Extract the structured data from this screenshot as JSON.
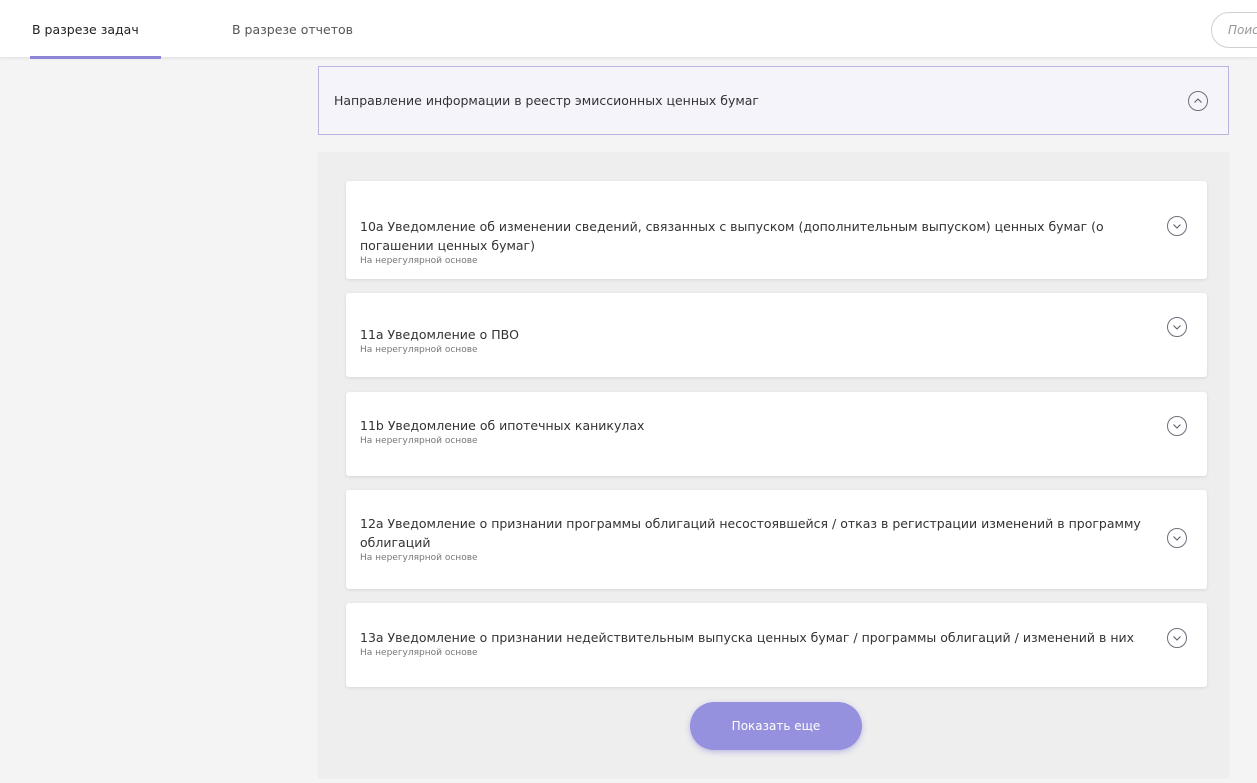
{
  "tabs": [
    {
      "label": "В разрезе задач",
      "active": true
    },
    {
      "label": "В разрезе отчетов",
      "active": false
    }
  ],
  "search": {
    "placeholder": "Поиск"
  },
  "section": {
    "title": "Направление информации в реестр эмиссионных ценных бумаг",
    "icon": "chevron-up-icon"
  },
  "items": [
    {
      "title": "10а Уведомление об изменении сведений, связанных с выпуском (дополнительным выпуском) ценных бумаг (о погашении ценных бумаг)",
      "frequency": "На нерегулярной основе",
      "icon": "chevron-down-icon"
    },
    {
      "title": "11а Уведомление о ПВО",
      "frequency": "На нерегулярной основе",
      "icon": "chevron-down-icon"
    },
    {
      "title": "11b Уведомление об ипотечных каникулах",
      "frequency": "На нерегулярной основе",
      "icon": "chevron-down-icon"
    },
    {
      "title": "12а Уведомление о признании программы облигаций несостоявшейся / отказ в регистрации изменений в программу облигаций",
      "frequency": "На нерегулярной основе",
      "icon": "chevron-down-icon"
    },
    {
      "title": "13а Уведомление о признании недействительным выпуска ценных бумаг / программы облигаций / изменений в них",
      "frequency": "На нерегулярной основе",
      "icon": "chevron-down-icon"
    }
  ],
  "show_more_label": "Показать еще",
  "colors": {
    "accent": "#8c84d6",
    "button": "#9691de",
    "header_border": "#b9b4e2",
    "header_bg": "#f5f4fb"
  }
}
